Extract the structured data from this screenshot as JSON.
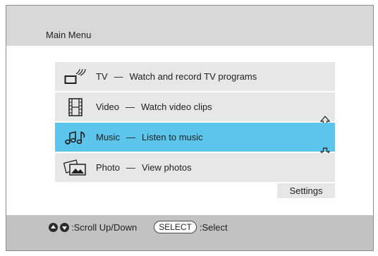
{
  "header": {
    "title": "Main Menu"
  },
  "menu": {
    "items": [
      {
        "label": "TV",
        "dash": "—",
        "desc": "Watch and record TV programs",
        "icon": "tv-icon",
        "selected": false
      },
      {
        "label": "Video",
        "dash": "—",
        "desc": "Watch video clips",
        "icon": "film-icon",
        "selected": false
      },
      {
        "label": "Music",
        "dash": "—",
        "desc": "Listen to music",
        "icon": "music-notes-icon",
        "selected": true
      },
      {
        "label": "Photo",
        "dash": "—",
        "desc": "View photos",
        "icon": "photos-icon",
        "selected": false
      }
    ],
    "scroll_up_icon": "scroll-up-arrow-icon",
    "scroll_down_icon": "scroll-down-arrow-icon"
  },
  "settings": {
    "label": "Settings"
  },
  "footer": {
    "scroll_hint": ":Scroll Up/Down",
    "select_button": "SELECT",
    "select_hint": ":Select"
  },
  "colors": {
    "header_bg": "#d8d8d8",
    "item_bg": "#e7e7e7",
    "selected_bg": "#5cc5ec",
    "footer_bg": "#c2c2c2"
  }
}
